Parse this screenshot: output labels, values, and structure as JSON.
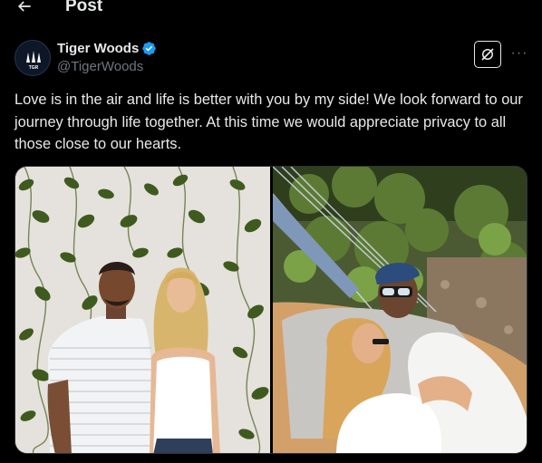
{
  "header": {
    "title": "Post",
    "back_icon": "arrow-left-icon"
  },
  "author": {
    "display_name": "Tiger Woods",
    "handle": "@TigerWoods",
    "avatar_text": "TGR",
    "verified": true,
    "verified_color": "#1d9bf0"
  },
  "actions": {
    "grok_icon": "grok-icon",
    "more_icon": "more-horizontal-icon",
    "more_label": "···"
  },
  "post": {
    "text": "Love is in the air and life is better with you by my side! We look forward to our journey through life together. At this time we would appreciate privacy to all those close to our hearts."
  },
  "media": {
    "photos": [
      {
        "id": "photo-1",
        "subject": "couple-standing-ivy-wall"
      },
      {
        "id": "photo-2",
        "subject": "couple-in-hammock"
      }
    ]
  },
  "colors": {
    "background": "#000000",
    "text": "#e7e9ea",
    "secondary_text": "#71767b",
    "border": "#2f3336"
  }
}
